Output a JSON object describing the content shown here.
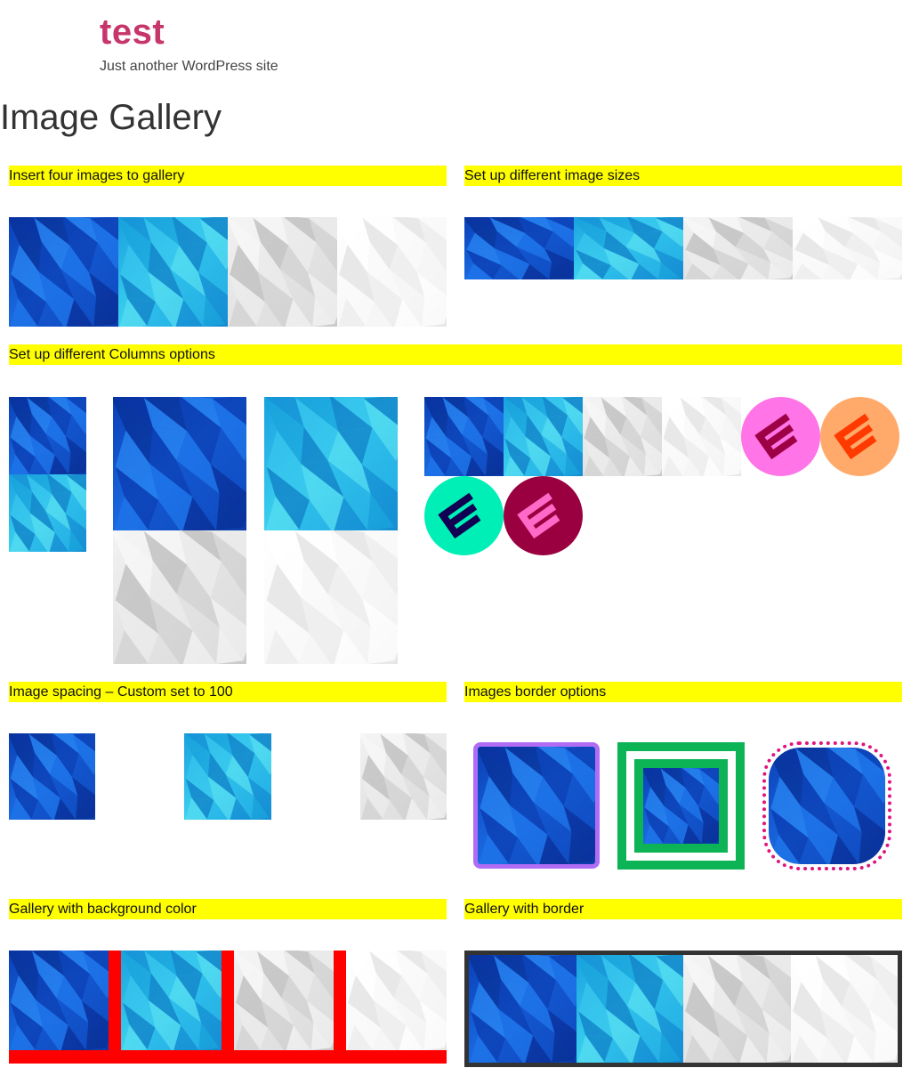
{
  "site": {
    "title": "test",
    "tagline": "Just another WordPress site"
  },
  "page": {
    "title": "Image Gallery"
  },
  "sections": {
    "insert_four": "Insert four images to gallery",
    "image_sizes": "Set up different image sizes",
    "columns": "Set up different Columns options",
    "spacing": "Image spacing – Custom set to 100",
    "border_options": "Images border options",
    "background_color": "Gallery with background color",
    "gallery_border": "Gallery with border"
  },
  "colors": {
    "site_title": "#c7366b",
    "highlight": "#ffff00",
    "bg_gallery": "#ff0000",
    "border_purple": "#b06cf5",
    "border_green": "#0cb455",
    "border_dotted": "#e0137f",
    "gallery_border": "#333333"
  },
  "icons": [
    {
      "name": "logo-icon-pink",
      "bg": "#ff74e6",
      "fg": "#9e0045"
    },
    {
      "name": "logo-icon-orange",
      "bg": "#ffaa6a",
      "fg": "#ff3a00"
    },
    {
      "name": "logo-icon-teal",
      "bg": "#00efb6",
      "fg": "#120052"
    },
    {
      "name": "logo-icon-maroon",
      "bg": "#9a0040",
      "fg": "#ff69c8"
    }
  ]
}
